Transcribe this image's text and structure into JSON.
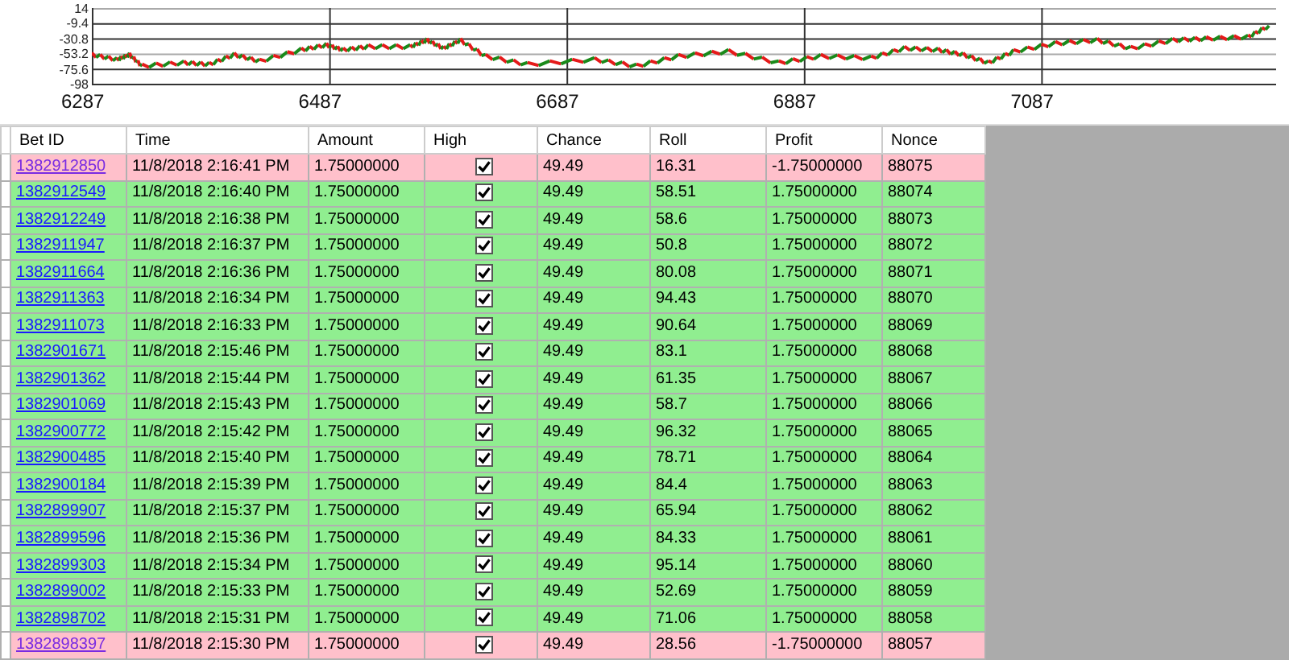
{
  "chart": {
    "y_tick_labels": [
      "14",
      "-9.4",
      "-30.8",
      "-53.2",
      "-75.6",
      "-98"
    ],
    "x_tick_labels": [
      "6287",
      "6487",
      "6687",
      "6887",
      "7087"
    ]
  },
  "table": {
    "columns": [
      "Bet ID",
      "Time",
      "Amount",
      "High",
      "Chance",
      "Roll",
      "Profit",
      "Nonce"
    ],
    "rows": [
      {
        "kind": "loss",
        "bet_id": "1382912850",
        "visited": true,
        "time": "11/8/2018 2:16:41 PM",
        "amount": "1.75000000",
        "high": true,
        "chance": "49.49",
        "roll": "16.31",
        "profit": "-1.75000000",
        "nonce": "88075"
      },
      {
        "kind": "win",
        "bet_id": "1382912549",
        "visited": false,
        "time": "11/8/2018 2:16:40 PM",
        "amount": "1.75000000",
        "high": true,
        "chance": "49.49",
        "roll": "58.51",
        "profit": "1.75000000",
        "nonce": "88074"
      },
      {
        "kind": "win",
        "bet_id": "1382912249",
        "visited": false,
        "time": "11/8/2018 2:16:38 PM",
        "amount": "1.75000000",
        "high": true,
        "chance": "49.49",
        "roll": "58.6",
        "profit": "1.75000000",
        "nonce": "88073"
      },
      {
        "kind": "win",
        "bet_id": "1382911947",
        "visited": false,
        "time": "11/8/2018 2:16:37 PM",
        "amount": "1.75000000",
        "high": true,
        "chance": "49.49",
        "roll": "50.8",
        "profit": "1.75000000",
        "nonce": "88072"
      },
      {
        "kind": "win",
        "bet_id": "1382911664",
        "visited": false,
        "time": "11/8/2018 2:16:36 PM",
        "amount": "1.75000000",
        "high": true,
        "chance": "49.49",
        "roll": "80.08",
        "profit": "1.75000000",
        "nonce": "88071"
      },
      {
        "kind": "win",
        "bet_id": "1382911363",
        "visited": false,
        "time": "11/8/2018 2:16:34 PM",
        "amount": "1.75000000",
        "high": true,
        "chance": "49.49",
        "roll": "94.43",
        "profit": "1.75000000",
        "nonce": "88070"
      },
      {
        "kind": "win",
        "bet_id": "1382911073",
        "visited": false,
        "time": "11/8/2018 2:16:33 PM",
        "amount": "1.75000000",
        "high": true,
        "chance": "49.49",
        "roll": "90.64",
        "profit": "1.75000000",
        "nonce": "88069"
      },
      {
        "kind": "win",
        "bet_id": "1382901671",
        "visited": false,
        "time": "11/8/2018 2:15:46 PM",
        "amount": "1.75000000",
        "high": true,
        "chance": "49.49",
        "roll": "83.1",
        "profit": "1.75000000",
        "nonce": "88068"
      },
      {
        "kind": "win",
        "bet_id": "1382901362",
        "visited": false,
        "time": "11/8/2018 2:15:44 PM",
        "amount": "1.75000000",
        "high": true,
        "chance": "49.49",
        "roll": "61.35",
        "profit": "1.75000000",
        "nonce": "88067"
      },
      {
        "kind": "win",
        "bet_id": "1382901069",
        "visited": false,
        "time": "11/8/2018 2:15:43 PM",
        "amount": "1.75000000",
        "high": true,
        "chance": "49.49",
        "roll": "58.7",
        "profit": "1.75000000",
        "nonce": "88066"
      },
      {
        "kind": "win",
        "bet_id": "1382900772",
        "visited": false,
        "time": "11/8/2018 2:15:42 PM",
        "amount": "1.75000000",
        "high": true,
        "chance": "49.49",
        "roll": "96.32",
        "profit": "1.75000000",
        "nonce": "88065"
      },
      {
        "kind": "win",
        "bet_id": "1382900485",
        "visited": false,
        "time": "11/8/2018 2:15:40 PM",
        "amount": "1.75000000",
        "high": true,
        "chance": "49.49",
        "roll": "78.71",
        "profit": "1.75000000",
        "nonce": "88064"
      },
      {
        "kind": "win",
        "bet_id": "1382900184",
        "visited": false,
        "time": "11/8/2018 2:15:39 PM",
        "amount": "1.75000000",
        "high": true,
        "chance": "49.49",
        "roll": "84.4",
        "profit": "1.75000000",
        "nonce": "88063"
      },
      {
        "kind": "win",
        "bet_id": "1382899907",
        "visited": false,
        "time": "11/8/2018 2:15:37 PM",
        "amount": "1.75000000",
        "high": true,
        "chance": "49.49",
        "roll": "65.94",
        "profit": "1.75000000",
        "nonce": "88062"
      },
      {
        "kind": "win",
        "bet_id": "1382899596",
        "visited": false,
        "time": "11/8/2018 2:15:36 PM",
        "amount": "1.75000000",
        "high": true,
        "chance": "49.49",
        "roll": "84.33",
        "profit": "1.75000000",
        "nonce": "88061"
      },
      {
        "kind": "win",
        "bet_id": "1382899303",
        "visited": false,
        "time": "11/8/2018 2:15:34 PM",
        "amount": "1.75000000",
        "high": true,
        "chance": "49.49",
        "roll": "95.14",
        "profit": "1.75000000",
        "nonce": "88060"
      },
      {
        "kind": "win",
        "bet_id": "1382899002",
        "visited": false,
        "time": "11/8/2018 2:15:33 PM",
        "amount": "1.75000000",
        "high": true,
        "chance": "49.49",
        "roll": "52.69",
        "profit": "1.75000000",
        "nonce": "88059"
      },
      {
        "kind": "win",
        "bet_id": "1382898702",
        "visited": false,
        "time": "11/8/2018 2:15:31 PM",
        "amount": "1.75000000",
        "high": true,
        "chance": "49.49",
        "roll": "71.06",
        "profit": "1.75000000",
        "nonce": "88058"
      },
      {
        "kind": "loss",
        "bet_id": "1382898397",
        "visited": true,
        "time": "11/8/2018 2:15:30 PM",
        "amount": "1.75000000",
        "high": true,
        "chance": "49.49",
        "roll": "28.56",
        "profit": "-1.75000000",
        "nonce": "88057"
      }
    ]
  }
}
